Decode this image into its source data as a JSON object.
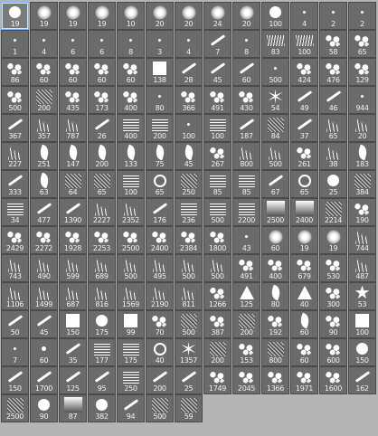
{
  "panel": {
    "name": "Brush Presets"
  },
  "brushes": [
    {
      "size": "19",
      "shape": "hard-round",
      "selected": true
    },
    {
      "size": "19",
      "shape": "soft-round"
    },
    {
      "size": "19",
      "shape": "soft-round"
    },
    {
      "size": "19",
      "shape": "soft-round"
    },
    {
      "size": "10",
      "shape": "soft-round"
    },
    {
      "size": "20",
      "shape": "soft-round"
    },
    {
      "size": "20",
      "shape": "soft-round"
    },
    {
      "size": "24",
      "shape": "soft-round"
    },
    {
      "size": "20",
      "shape": "soft-round"
    },
    {
      "size": "100",
      "shape": "hard-round"
    },
    {
      "size": "4",
      "shape": "dot"
    },
    {
      "size": "2",
      "shape": "dot"
    },
    {
      "size": "2",
      "shape": "dot"
    },
    {
      "size": "1",
      "shape": "dot"
    },
    {
      "size": "4",
      "shape": "dot"
    },
    {
      "size": "6",
      "shape": "dot"
    },
    {
      "size": "6",
      "shape": "dot"
    },
    {
      "size": "8",
      "shape": "dot"
    },
    {
      "size": "3",
      "shape": "dot"
    },
    {
      "size": "4",
      "shape": "dot"
    },
    {
      "size": "7",
      "shape": "streak"
    },
    {
      "size": "8",
      "shape": "dot"
    },
    {
      "size": "83",
      "shape": "stroke"
    },
    {
      "size": "100",
      "shape": "stroke"
    },
    {
      "size": "58",
      "shape": "splat"
    },
    {
      "size": "65",
      "shape": "splat"
    },
    {
      "size": "86",
      "shape": "splat"
    },
    {
      "size": "60",
      "shape": "splat"
    },
    {
      "size": "60",
      "shape": "splat"
    },
    {
      "size": "60",
      "shape": "splat"
    },
    {
      "size": "60",
      "shape": "splat"
    },
    {
      "size": "138",
      "shape": "square"
    },
    {
      "size": "28",
      "shape": "streak"
    },
    {
      "size": "45",
      "shape": "streak"
    },
    {
      "size": "60",
      "shape": "streak"
    },
    {
      "size": "500",
      "shape": "dot"
    },
    {
      "size": "424",
      "shape": "splat"
    },
    {
      "size": "476",
      "shape": "splat"
    },
    {
      "size": "129",
      "shape": "splat"
    },
    {
      "size": "500",
      "shape": "splat"
    },
    {
      "size": "200",
      "shape": "texture"
    },
    {
      "size": "435",
      "shape": "splat"
    },
    {
      "size": "173",
      "shape": "splat"
    },
    {
      "size": "400",
      "shape": "splat"
    },
    {
      "size": "80",
      "shape": "dot"
    },
    {
      "size": "366",
      "shape": "splat"
    },
    {
      "size": "491",
      "shape": "splat"
    },
    {
      "size": "430",
      "shape": "splat"
    },
    {
      "size": "54",
      "shape": "burst"
    },
    {
      "size": "49",
      "shape": "streak"
    },
    {
      "size": "46",
      "shape": "streak"
    },
    {
      "size": "944",
      "shape": "dot"
    },
    {
      "size": "367",
      "shape": "streak"
    },
    {
      "size": "357",
      "shape": "grass"
    },
    {
      "size": "787",
      "shape": "grass"
    },
    {
      "size": "26",
      "shape": "streak"
    },
    {
      "size": "400",
      "shape": "lines"
    },
    {
      "size": "200",
      "shape": "lines"
    },
    {
      "size": "100",
      "shape": "dot"
    },
    {
      "size": "100",
      "shape": "lines"
    },
    {
      "size": "187",
      "shape": "streak"
    },
    {
      "size": "84",
      "shape": "texture"
    },
    {
      "size": "37",
      "shape": "streak"
    },
    {
      "size": "65",
      "shape": "grass"
    },
    {
      "size": "20",
      "shape": "grass"
    },
    {
      "size": "227",
      "shape": "grass"
    },
    {
      "size": "251",
      "shape": "leaf"
    },
    {
      "size": "147",
      "shape": "leaf"
    },
    {
      "size": "200",
      "shape": "leaf"
    },
    {
      "size": "133",
      "shape": "leaf"
    },
    {
      "size": "75",
      "shape": "leaf"
    },
    {
      "size": "45",
      "shape": "leaf"
    },
    {
      "size": "267",
      "shape": "splat"
    },
    {
      "size": "800",
      "shape": "grass"
    },
    {
      "size": "500",
      "shape": "grass"
    },
    {
      "size": "261",
      "shape": "splat"
    },
    {
      "size": "38",
      "shape": "grass"
    },
    {
      "size": "183",
      "shape": "leaf"
    },
    {
      "size": "333",
      "shape": "streak"
    },
    {
      "size": "63",
      "shape": "leaf"
    },
    {
      "size": "64",
      "shape": "texture"
    },
    {
      "size": "65",
      "shape": "texture"
    },
    {
      "size": "100",
      "shape": "lines"
    },
    {
      "size": "65",
      "shape": "ring"
    },
    {
      "size": "250",
      "shape": "texture"
    },
    {
      "size": "85",
      "shape": "lines"
    },
    {
      "size": "85",
      "shape": "lines"
    },
    {
      "size": "67",
      "shape": "streak"
    },
    {
      "size": "65",
      "shape": "ring"
    },
    {
      "size": "25",
      "shape": "hard-round"
    },
    {
      "size": "384",
      "shape": "texture"
    },
    {
      "size": "34",
      "shape": "lines"
    },
    {
      "size": "477",
      "shape": "streak"
    },
    {
      "size": "1390",
      "shape": "streak"
    },
    {
      "size": "2227",
      "shape": "grass"
    },
    {
      "size": "2352",
      "shape": "grass"
    },
    {
      "size": "176",
      "shape": "streak"
    },
    {
      "size": "236",
      "shape": "lines"
    },
    {
      "size": "500",
      "shape": "lines"
    },
    {
      "size": "2200",
      "shape": "lines"
    },
    {
      "size": "2500",
      "shape": "gradient"
    },
    {
      "size": "2400",
      "shape": "gradient"
    },
    {
      "size": "2214",
      "shape": "texture"
    },
    {
      "size": "190",
      "shape": "splat"
    },
    {
      "size": "2429",
      "shape": "splat"
    },
    {
      "size": "2272",
      "shape": "splat"
    },
    {
      "size": "1928",
      "shape": "splat"
    },
    {
      "size": "2253",
      "shape": "splat"
    },
    {
      "size": "2500",
      "shape": "splat"
    },
    {
      "size": "2400",
      "shape": "splat"
    },
    {
      "size": "2384",
      "shape": "splat"
    },
    {
      "size": "1800",
      "shape": "splat"
    },
    {
      "size": "43",
      "shape": "dot"
    },
    {
      "size": "60",
      "shape": "soft-round"
    },
    {
      "size": "19",
      "shape": "soft-round"
    },
    {
      "size": "19",
      "shape": "soft-round"
    },
    {
      "size": "744",
      "shape": "grass"
    },
    {
      "size": "743",
      "shape": "grass"
    },
    {
      "size": "490",
      "shape": "grass"
    },
    {
      "size": "599",
      "shape": "grass"
    },
    {
      "size": "689",
      "shape": "grass"
    },
    {
      "size": "500",
      "shape": "grass"
    },
    {
      "size": "495",
      "shape": "grass"
    },
    {
      "size": "500",
      "shape": "grass"
    },
    {
      "size": "500",
      "shape": "grass"
    },
    {
      "size": "491",
      "shape": "splat"
    },
    {
      "size": "400",
      "shape": "splat"
    },
    {
      "size": "679",
      "shape": "splat"
    },
    {
      "size": "530",
      "shape": "splat"
    },
    {
      "size": "487",
      "shape": "grass"
    },
    {
      "size": "1106",
      "shape": "grass"
    },
    {
      "size": "1499",
      "shape": "grass"
    },
    {
      "size": "687",
      "shape": "grass"
    },
    {
      "size": "816",
      "shape": "grass"
    },
    {
      "size": "1569",
      "shape": "grass"
    },
    {
      "size": "2190",
      "shape": "grass"
    },
    {
      "size": "811",
      "shape": "grass"
    },
    {
      "size": "1266",
      "shape": "splat"
    },
    {
      "size": "125",
      "shape": "triangle"
    },
    {
      "size": "80",
      "shape": "leaf"
    },
    {
      "size": "40",
      "shape": "triangle"
    },
    {
      "size": "300",
      "shape": "splat"
    },
    {
      "size": "53",
      "shape": "star"
    },
    {
      "size": "50",
      "shape": "streak"
    },
    {
      "size": "45",
      "shape": "streak"
    },
    {
      "size": "150",
      "shape": "square"
    },
    {
      "size": "175",
      "shape": "hard-round"
    },
    {
      "size": "99",
      "shape": "square"
    },
    {
      "size": "70",
      "shape": "splat"
    },
    {
      "size": "500",
      "shape": "texture"
    },
    {
      "size": "387",
      "shape": "splat"
    },
    {
      "size": "200",
      "shape": "texture"
    },
    {
      "size": "192",
      "shape": "splat"
    },
    {
      "size": "60",
      "shape": "leaf"
    },
    {
      "size": "90",
      "shape": "splat"
    },
    {
      "size": "100",
      "shape": "square"
    },
    {
      "size": "7",
      "shape": "dot"
    },
    {
      "size": "60",
      "shape": "dotsm"
    },
    {
      "size": "35",
      "shape": "streak"
    },
    {
      "size": "177",
      "shape": "lines"
    },
    {
      "size": "175",
      "shape": "lines"
    },
    {
      "size": "40",
      "shape": "ring"
    },
    {
      "size": "1357",
      "shape": "burst"
    },
    {
      "size": "200",
      "shape": "texture"
    },
    {
      "size": "153",
      "shape": "splat"
    },
    {
      "size": "800",
      "shape": "texture"
    },
    {
      "size": "60",
      "shape": "splat"
    },
    {
      "size": "600",
      "shape": "splat"
    },
    {
      "size": "150",
      "shape": "hard-round"
    },
    {
      "size": "150",
      "shape": "streak"
    },
    {
      "size": "1700",
      "shape": "streak"
    },
    {
      "size": "125",
      "shape": "streak"
    },
    {
      "size": "95",
      "shape": "streak"
    },
    {
      "size": "250",
      "shape": "lines"
    },
    {
      "size": "200",
      "shape": "streak"
    },
    {
      "size": "25",
      "shape": "streak"
    },
    {
      "size": "1749",
      "shape": "splat"
    },
    {
      "size": "2045",
      "shape": "splat"
    },
    {
      "size": "1366",
      "shape": "splat"
    },
    {
      "size": "1971",
      "shape": "splat"
    },
    {
      "size": "1600",
      "shape": "splat"
    },
    {
      "size": "162",
      "shape": "streak"
    },
    {
      "size": "2500",
      "shape": "texture"
    },
    {
      "size": "90",
      "shape": "hard-round"
    },
    {
      "size": "87",
      "shape": "gradient"
    },
    {
      "size": "382",
      "shape": "hard-round"
    },
    {
      "size": "94",
      "shape": "streak"
    },
    {
      "size": "500",
      "shape": "texture"
    },
    {
      "size": "59",
      "shape": "texture"
    }
  ]
}
